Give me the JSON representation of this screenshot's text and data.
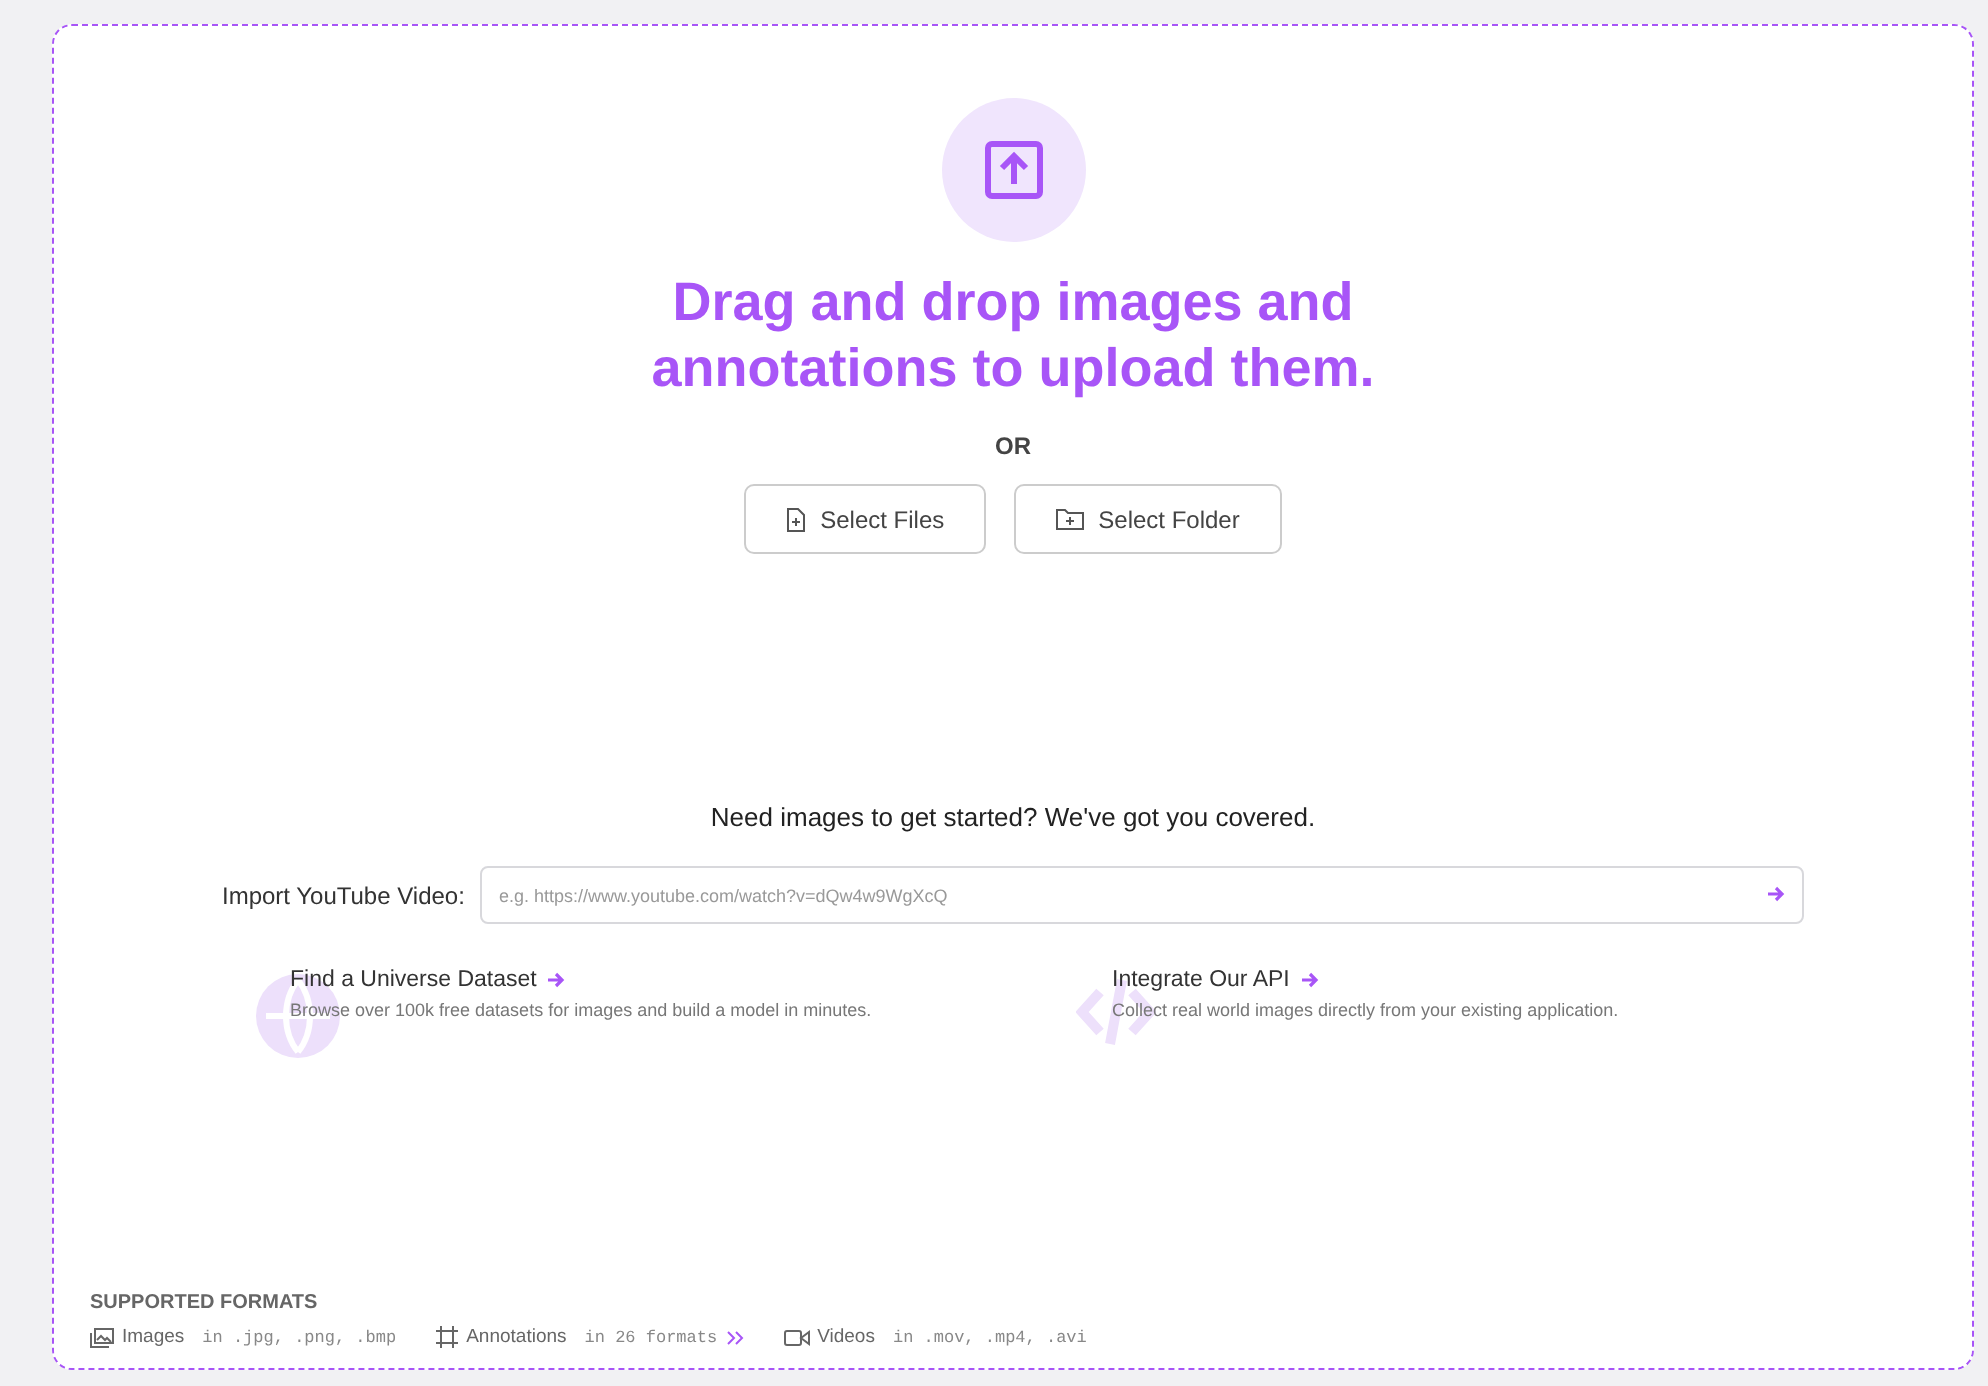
{
  "upload": {
    "title": "Drag and drop images and annotations to upload them.",
    "or": "OR",
    "buttons": [
      {
        "kind": "file",
        "label": "Select Files"
      },
      {
        "kind": "folder",
        "label": "Select Folder"
      }
    ]
  },
  "help": {
    "heading": "Need images to get started? We've got you covered.",
    "youtube": {
      "label": "Import YouTube Video:",
      "placeholder": "e.g. https://www.youtube.com/watch?v=dQw4w9WgXcQ"
    },
    "links": [
      {
        "kind": "globe",
        "title": "Find a Universe Dataset",
        "description": "Browse over 100k free datasets for images and build a model in minutes."
      },
      {
        "kind": "code",
        "title": "Integrate Our API",
        "description": "Collect real world images directly from your existing application."
      }
    ]
  },
  "formats": {
    "heading": "SUPPORTED FORMATS",
    "items": [
      {
        "kind": "image",
        "name": "Images",
        "detail": "in .jpg, .png, .bmp",
        "more": false
      },
      {
        "kind": "annotation",
        "name": "Annotations",
        "detail": "in 26 formats",
        "more": true
      },
      {
        "kind": "video",
        "name": "Videos",
        "detail": "in .mov, .mp4, .avi",
        "more": false
      }
    ]
  }
}
